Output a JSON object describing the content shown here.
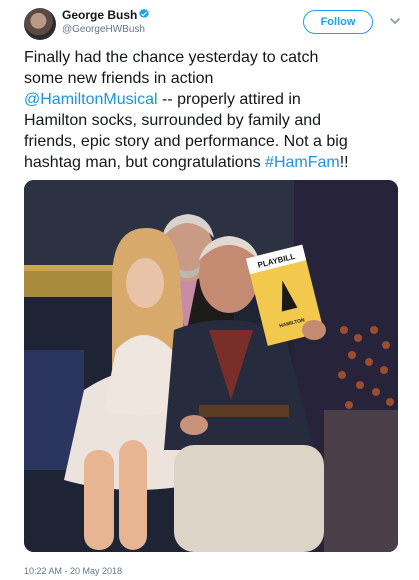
{
  "author": {
    "name": "George Bush",
    "handle": "@GeorgeHWBush",
    "verified_color": "#1da1f2"
  },
  "follow_button": {
    "label": "Follow"
  },
  "tweet": {
    "lines": [
      [
        {
          "t": "Finally had the chance yesterday to catch",
          "link": false
        }
      ],
      [
        {
          "t": "some new friends in action",
          "link": false
        }
      ],
      [
        {
          "t": "@HamiltonMusical",
          "link": true
        },
        {
          "t": " -- properly attired in",
          "link": false
        }
      ],
      [
        {
          "t": "Hamilton socks, surrounded by family and",
          "link": false
        }
      ],
      [
        {
          "t": "friends, epic story and performance. Not a big",
          "link": false
        }
      ],
      [
        {
          "t": "hashtag man, but congratulations ",
          "link": false
        },
        {
          "t": "#HamFam",
          "link": true
        },
        {
          "t": "!!",
          "link": false
        }
      ]
    ],
    "timestamp": "10:22 AM - 20 May 2018"
  },
  "photo": {
    "playbill_title": "PLAYBILL",
    "playbill_subtitle": "HAMILTON"
  },
  "colors": {
    "link": "#1b95e0",
    "accent": "#1da1f2",
    "muted": "#657786"
  }
}
